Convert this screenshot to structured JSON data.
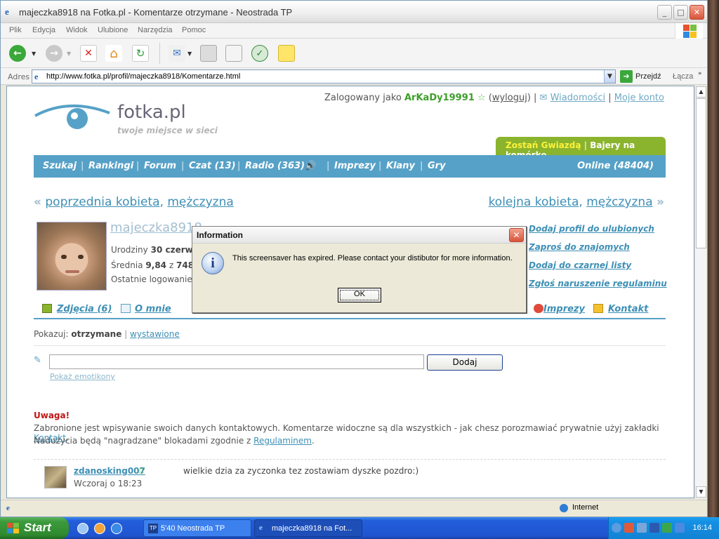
{
  "window": {
    "title": "majeczka8918 na Fotka.pl - Komentarze otrzymane - Neostrada TP",
    "menu": [
      "Plik",
      "Edycja",
      "Widok",
      "Ulubione",
      "Narzędzia",
      "Pomoc"
    ],
    "address_label": "Adres",
    "url": "http://www.fotka.pl/profil/majeczka8918/Komentarze.html",
    "go_label": "Przejdź",
    "links_label": "Łącza",
    "status_zone": "Internet"
  },
  "site": {
    "logo_text": "fotka.pl",
    "logo_tagline": "twoje miejsce w sieci",
    "logged_as_prefix": "Zalogowany jako",
    "username": "ArKaDy19991",
    "logout": "wyloguj",
    "messages": "Wiadomości",
    "my_account": "Moje konto",
    "star_link": "Zostań Gwiazdą",
    "ringtones_link": "Bajery na komórkę",
    "nav": {
      "search": "Szukaj",
      "rankings": "Rankingi",
      "forum": "Forum",
      "chat": "Czat (13)",
      "radio": "Radio (363)",
      "events": "Imprezy",
      "clans": "Klany",
      "games": "Gry",
      "online": "Online (48404)"
    },
    "prev_label": "poprzednia kobieta",
    "prev_label2": "mężczyzna",
    "next_label": "kolejna kobieta",
    "next_label2": "mężczyzna"
  },
  "profile": {
    "name": "majeczka8918",
    "birthday_label": "Urodziny",
    "birthday_value": "30 czerwca",
    "average_label": "Średnia",
    "average_value": "9,84",
    "average_of": "z",
    "average_count": "748",
    "last_login_label": "Ostatnie logowanie",
    "actions": [
      "Dodaj profil do ulubionych",
      "Zaproś do znajomych",
      "Dodaj do czarnej listy",
      "Zgłoś naruszenie regulaminu"
    ]
  },
  "tabs": {
    "photos": "Zdjęcia (6)",
    "about": "O mnie",
    "events": "Imprezy",
    "contact": "Kontakt"
  },
  "comments": {
    "show_label": "Pokazuj:",
    "received": "otrzymane",
    "given": "wystawione",
    "add_button": "Dodaj",
    "emoticons_link": "Pokaż emotikony",
    "warning_title": "Uwaga!",
    "warning_line1": "Zabronione jest wpisywanie swoich danych kontaktowych. Komentarze widoczne są dla wszystkich - jak chesz porozmawiać prywatnie użyj zakładki",
    "warning_link1": "Kontakt",
    "warning_line2": "Nadużycia będą \"nagradzane\" blokadami zgodnie z",
    "warning_link2": "Regulaminem",
    "items": [
      {
        "user": "zdanosking007",
        "time": "Wczoraj o 18:23",
        "text": "wielkie dzia za zyczonka tez zostawiam dyszke pozdro:)"
      }
    ]
  },
  "dialog": {
    "title": "Information",
    "message": "This screensaver has expired. Please contact your distibutor for more information.",
    "ok": "OK"
  },
  "taskbar": {
    "start": "Start",
    "tasks": [
      "5'40 Neostrada TP",
      "majeczka8918 na Fot..."
    ],
    "clock": "16:14"
  }
}
